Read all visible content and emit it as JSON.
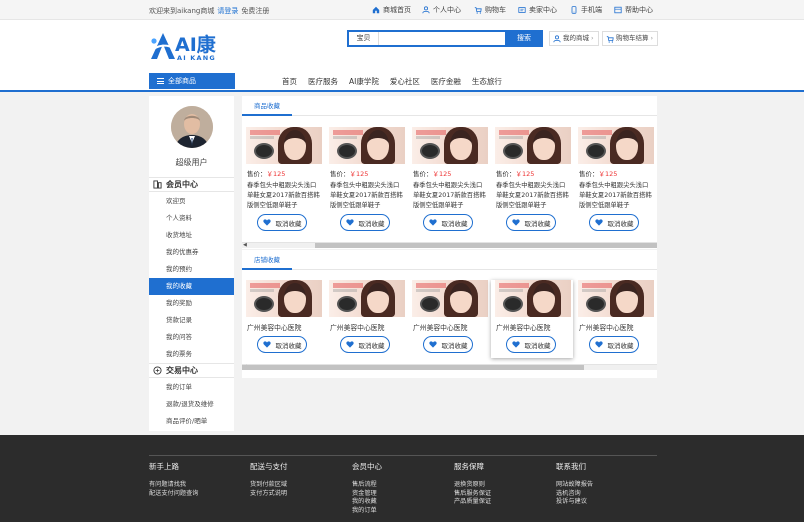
{
  "topbar": {
    "welcome": "欢迎来到aikang商城",
    "login": "请登录",
    "register": "免费注册",
    "nav": [
      {
        "label": "商城首页",
        "icon": "home-icon"
      },
      {
        "label": "个人中心",
        "icon": "user-icon"
      },
      {
        "label": "购物车",
        "icon": "cart-icon"
      },
      {
        "label": "卖家中心",
        "icon": "seller-icon"
      },
      {
        "label": "手机端",
        "icon": "mobile-icon"
      },
      {
        "label": "帮助中心",
        "icon": "help-icon"
      }
    ]
  },
  "logo": {
    "main": "AI康",
    "sub": "AI KANG"
  },
  "search": {
    "category": "宝贝",
    "placeholder": "",
    "button": "搜索"
  },
  "header_buttons": {
    "my_mall": "我的商城",
    "cart_checkout": "购物车结算"
  },
  "navbar": {
    "all_categories": "全部商品",
    "items": [
      "首页",
      "医疗服务",
      "AI康学院",
      "爱心社区",
      "医疗金融",
      "生态旅行"
    ]
  },
  "sidebar": {
    "username": "超级用户",
    "member_center": "会员中心",
    "member_items": [
      "欢迎页",
      "个人资料",
      "收货地址",
      "我的优惠券",
      "我的预约",
      "我的收藏",
      "我的奖励",
      "贷款记录",
      "我的问答",
      "我的票务"
    ],
    "active_item": "我的收藏",
    "trade_center": "交易中心",
    "trade_items": [
      "我的订单",
      "退款/退货及维修",
      "商品评价/晒单"
    ]
  },
  "favorites_goods": {
    "tab": "商品收藏",
    "items": [
      {
        "price_label": "售价：",
        "price": "￥125",
        "desc": "春季包头中粗跟尖头浅口单鞋女夏2017新款百搭韩版侧空低跟单鞋子",
        "button": "取消收藏"
      },
      {
        "price_label": "售价：",
        "price": "￥125",
        "desc": "春季包头中粗跟尖头浅口单鞋女夏2017新款百搭韩版侧空低跟单鞋子",
        "button": "取消收藏"
      },
      {
        "price_label": "售价：",
        "price": "￥125",
        "desc": "春季包头中粗跟尖头浅口单鞋女夏2017新款百搭韩版侧空低跟单鞋子",
        "button": "取消收藏"
      },
      {
        "price_label": "售价：",
        "price": "￥125",
        "desc": "春季包头中粗跟尖头浅口单鞋女夏2017新款百搭韩版侧空低跟单鞋子",
        "button": "取消收藏"
      },
      {
        "price_label": "售价：",
        "price": "￥125",
        "desc": "春季包头中粗跟尖头浅口单鞋女夏2017新款百搭韩版侧空低跟单鞋子",
        "button": "取消收藏"
      }
    ]
  },
  "favorites_shops": {
    "tab": "店铺收藏",
    "items": [
      {
        "name": "广州美容中心医院",
        "button": "取消收藏"
      },
      {
        "name": "广州美容中心医院",
        "button": "取消收藏"
      },
      {
        "name": "广州美容中心医院",
        "button": "取消收藏"
      },
      {
        "name": "广州美容中心医院",
        "button": "取消收藏"
      },
      {
        "name": "广州美容中心医院",
        "button": "取消收藏"
      }
    ]
  },
  "footer": {
    "columns": [
      {
        "title": "新手上路",
        "links": [
          "有问题请找我",
          "配送支付问题查询"
        ]
      },
      {
        "title": "配送与支付",
        "links": [
          "货到付款区域",
          "支付方式说明"
        ]
      },
      {
        "title": "会员中心",
        "links": [
          "售后流程",
          "资金管理",
          "我的收藏",
          "我的订单"
        ]
      },
      {
        "title": "服务保障",
        "links": [
          "退换货原则",
          "售后服务保证",
          "产品质量保证"
        ]
      },
      {
        "title": "联系我们",
        "links": [
          "网站故障报告",
          "选机咨询",
          "投诉与建议"
        ]
      }
    ]
  },
  "colors": {
    "accent": "#1f6fd0",
    "price": "#e33333",
    "footer_bg": "#2c2c2c"
  }
}
